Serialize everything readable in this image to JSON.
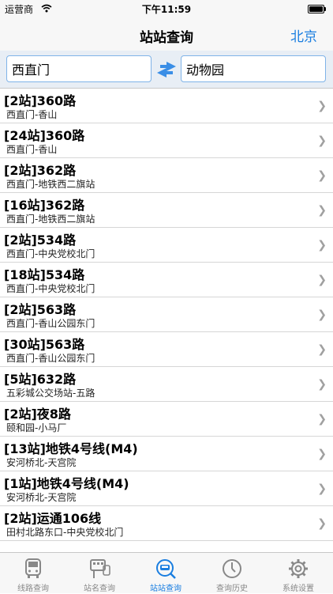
{
  "status_bar": {
    "carrier": "运营商",
    "time": "下午11:59"
  },
  "nav": {
    "title": "站站查询",
    "city": "北京"
  },
  "search": {
    "from_value": "西直门",
    "to_value": "动物园"
  },
  "routes": [
    {
      "title": "[2站]360路",
      "desc": "西直门-香山"
    },
    {
      "title": "[24站]360路",
      "desc": "西直门-香山"
    },
    {
      "title": "[2站]362路",
      "desc": "西直门-地铁西二旗站"
    },
    {
      "title": "[16站]362路",
      "desc": "西直门-地铁西二旗站"
    },
    {
      "title": "[2站]534路",
      "desc": "西直门-中央党校北门"
    },
    {
      "title": "[18站]534路",
      "desc": "西直门-中央党校北门"
    },
    {
      "title": "[2站]563路",
      "desc": "西直门-香山公园东门"
    },
    {
      "title": "[30站]563路",
      "desc": "西直门-香山公园东门"
    },
    {
      "title": "[5站]632路",
      "desc": "五彩城公交场站-五路"
    },
    {
      "title": "[2站]夜8路",
      "desc": "颐和园-小马厂"
    },
    {
      "title": "[13站]地铁4号线(M4)",
      "desc": "安河桥北-天宫院"
    },
    {
      "title": "[1站]地铁4号线(M4)",
      "desc": "安河桥北-天宫院"
    },
    {
      "title": "[2站]运通106线",
      "desc": "田村北路东口-中央党校北门"
    }
  ],
  "tabs": [
    {
      "label": "线路查询",
      "icon": "bus-icon"
    },
    {
      "label": "站名查询",
      "icon": "bus-stop-icon"
    },
    {
      "label": "站站查询",
      "icon": "search-bus-icon",
      "active": true
    },
    {
      "label": "查询历史",
      "icon": "clock-icon"
    },
    {
      "label": "系统设置",
      "icon": "gear-icon"
    }
  ],
  "colors": {
    "accent": "#1a7ee0",
    "tab_inactive": "#888888",
    "search_bg": "#e8eef5"
  }
}
